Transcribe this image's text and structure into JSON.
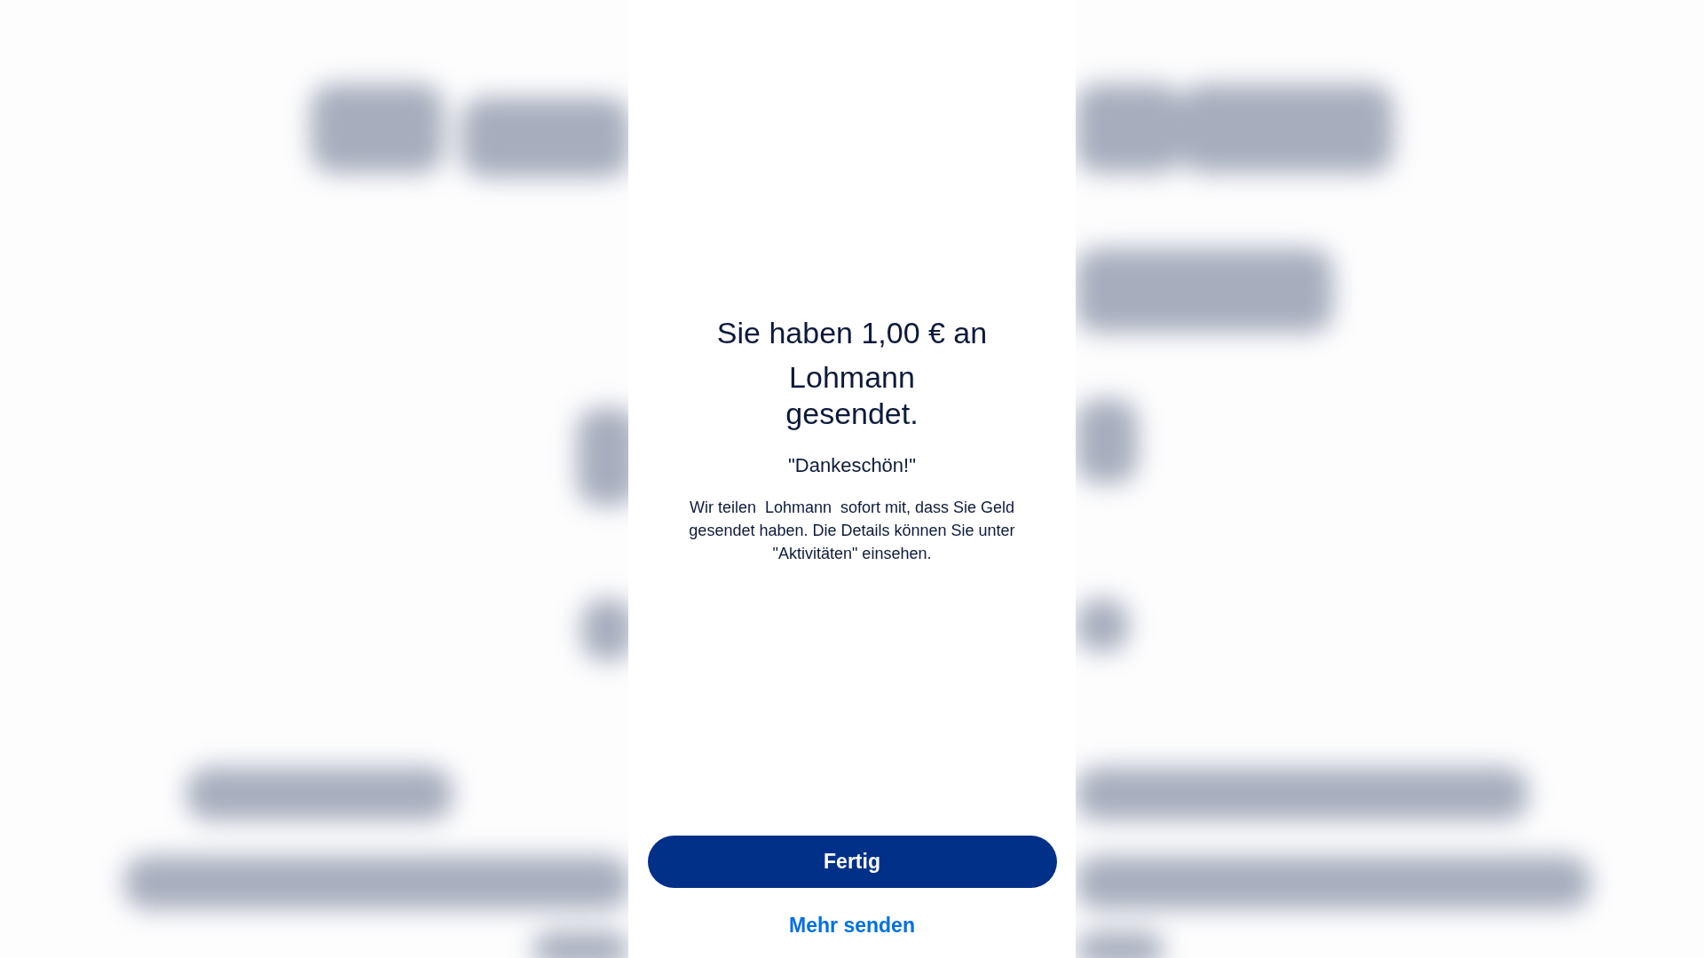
{
  "confirmation": {
    "heading_lines": [
      "Sie haben 1,00 € an",
      "Lohmann gesendet."
    ],
    "note": "\"Dankeschön!\"",
    "message": "Wir teilen  Lohmann  sofort mit, dass Sie Geld gesendet haben. Die Details können Sie unter \"Aktivitäten\" einsehen."
  },
  "actions": {
    "primary_button": "Fertig",
    "secondary_link": "Mehr senden"
  }
}
